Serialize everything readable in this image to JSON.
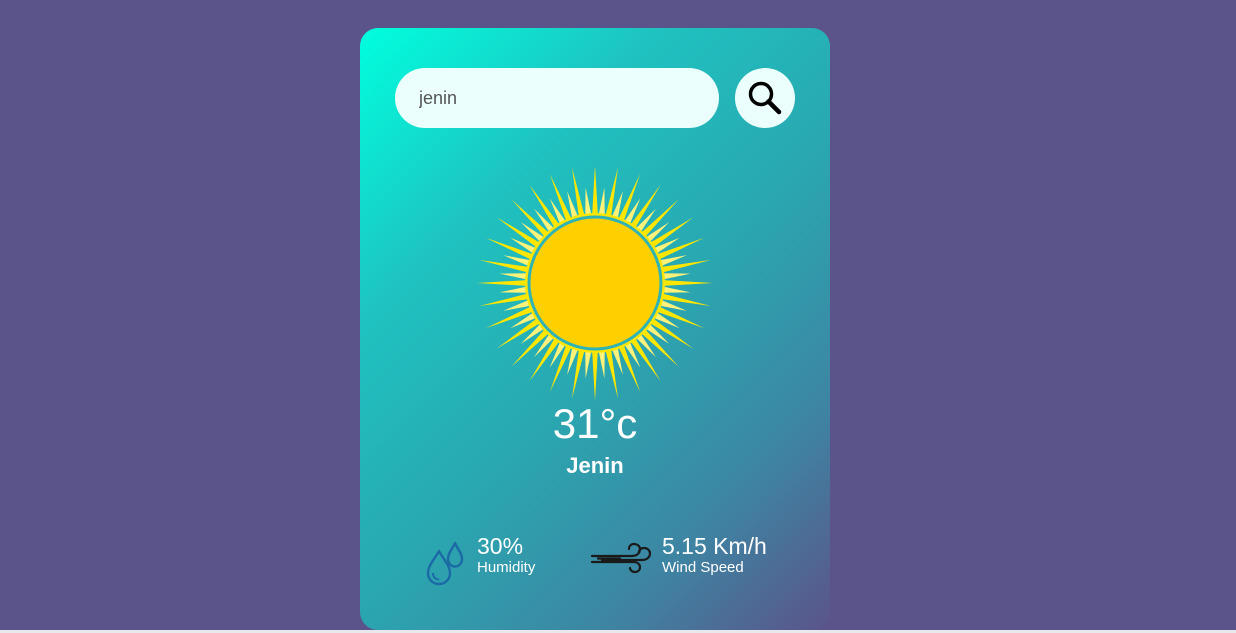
{
  "search": {
    "value": "jenin",
    "placeholder": ""
  },
  "weather": {
    "icon": "sun-icon",
    "temperature": "31°c",
    "city": "Jenin"
  },
  "details": {
    "humidity_value": "30%",
    "humidity_label": "Humidity",
    "humidity_icon": "humidity-drops-icon",
    "wind_value": "5.15 Km/h",
    "wind_label": "Wind Speed",
    "wind_icon": "wind-icon"
  },
  "colors": {
    "page_background": "#5b548a",
    "card_gradient_start": "#00ffde",
    "card_gradient_end": "#5b548a",
    "input_background": "#ebfffc",
    "sun": "#ffd000",
    "sun_rays": "#ffe600",
    "humidity_icon": "#1b6aa5"
  }
}
